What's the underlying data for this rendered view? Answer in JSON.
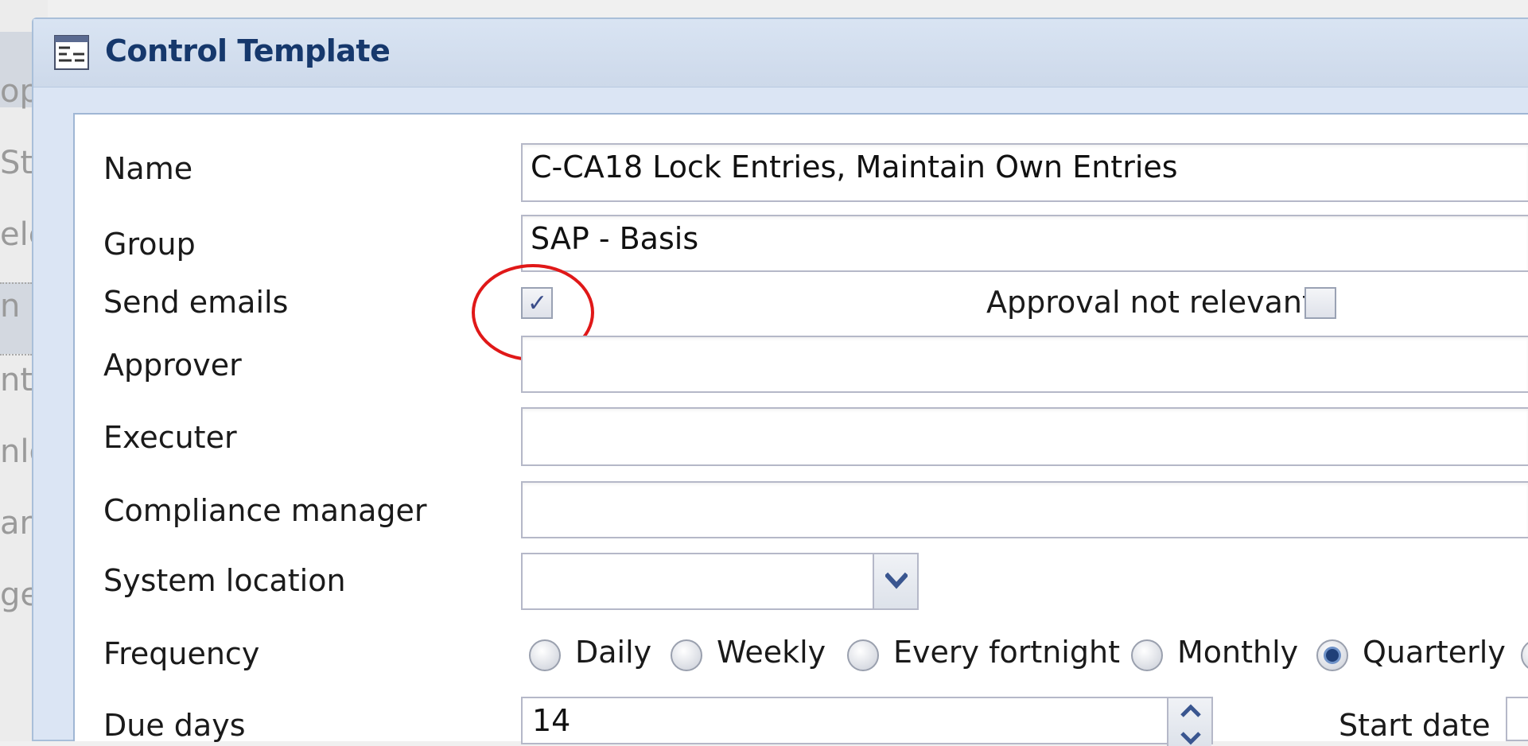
{
  "background_app": {
    "fragments": [
      "op",
      "Sta",
      "elet",
      "n C",
      "nt",
      "nlo",
      "am",
      "ge"
    ]
  },
  "dialog": {
    "title": "Control Template",
    "icon": "form-window-icon"
  },
  "form": {
    "name": {
      "label": "Name",
      "value": "C-CA18 Lock Entries, Maintain Own Entries"
    },
    "group": {
      "label": "Group",
      "value": "SAP - Basis"
    },
    "send_emails": {
      "label": "Send emails",
      "checked": true
    },
    "approval_not_relevant": {
      "label": "Approval not relevant",
      "checked": false
    },
    "approver": {
      "label": "Approver",
      "value": ""
    },
    "executer": {
      "label": "Executer",
      "value": ""
    },
    "compliance_manager": {
      "label": "Compliance manager",
      "value": ""
    },
    "system_location": {
      "label": "System location",
      "value": ""
    },
    "frequency": {
      "label": "Frequency",
      "options": [
        "Daily",
        "Weekly",
        "Every fortnight",
        "Monthly",
        "Quarterly"
      ],
      "selected": "Quarterly"
    },
    "due_days": {
      "label": "Due days",
      "value": "14"
    },
    "start_date": {
      "label": "Start date",
      "value": ""
    }
  },
  "colors": {
    "title_text": "#16386c",
    "highlight_circle": "#e01818",
    "radio_selected": "#1f3f78"
  }
}
